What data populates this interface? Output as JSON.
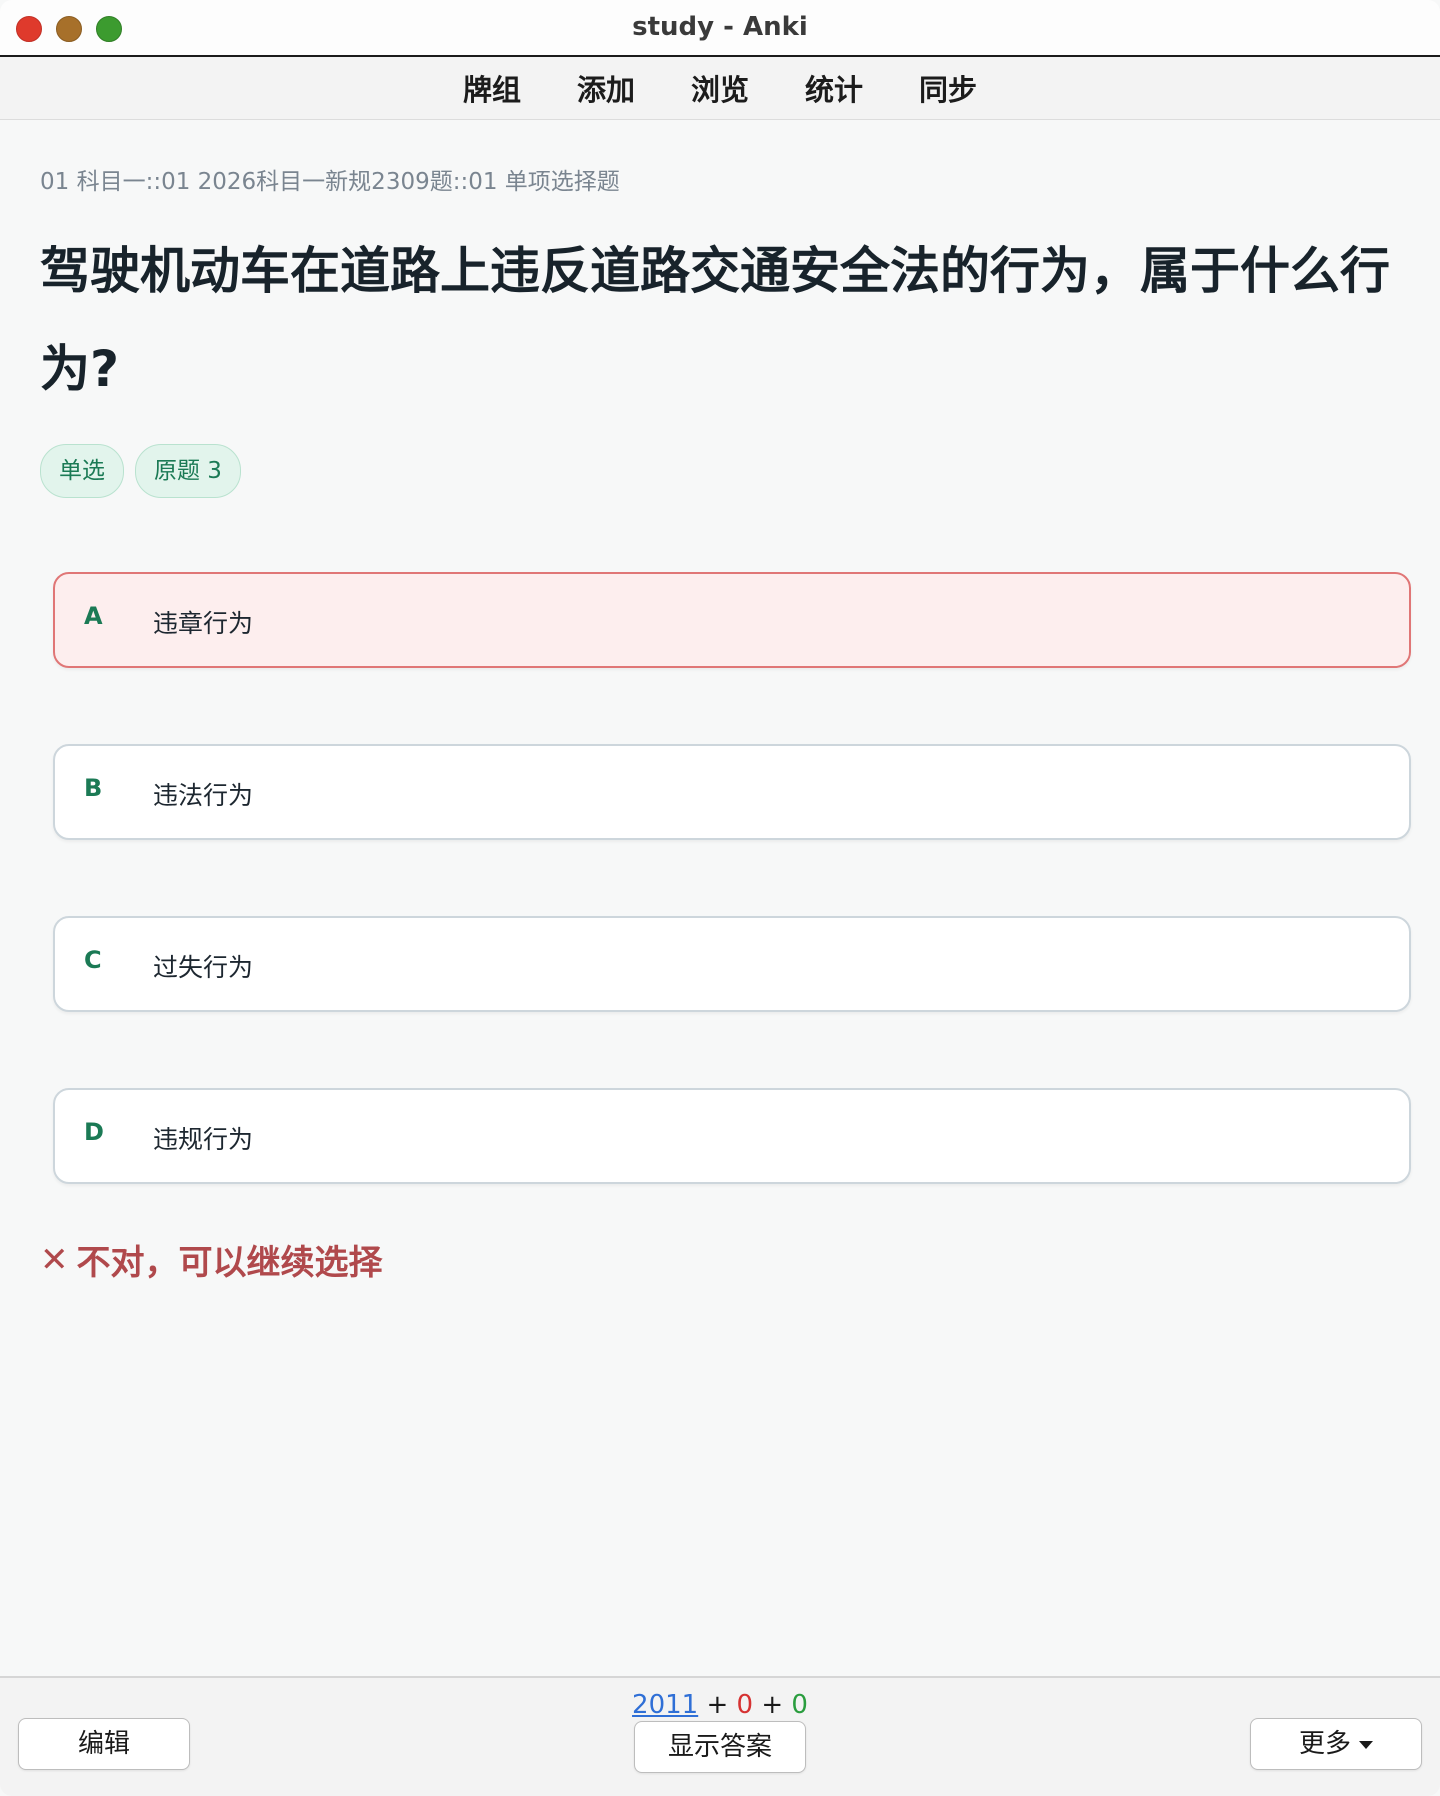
{
  "window": {
    "title": "study - Anki"
  },
  "toolbar": {
    "items": [
      {
        "label": "牌组"
      },
      {
        "label": "添加"
      },
      {
        "label": "浏览"
      },
      {
        "label": "统计"
      },
      {
        "label": "同步"
      }
    ]
  },
  "card": {
    "deck_path": "01 科目一::01 2026科目一新规2309题::01 单项选择题",
    "question": "驾驶机动车在道路上违反道路交通安全法的行为，属于什么行为?",
    "tags": [
      "单选",
      "原题 3"
    ],
    "options": [
      {
        "letter": "A",
        "text": "违章行为",
        "state": "wrong"
      },
      {
        "letter": "B",
        "text": "违法行为",
        "state": "normal"
      },
      {
        "letter": "C",
        "text": "过失行为",
        "state": "normal"
      },
      {
        "letter": "D",
        "text": "违规行为",
        "state": "normal"
      }
    ],
    "feedback": {
      "icon": "✕",
      "text": "不对，可以继续选择"
    }
  },
  "bottom": {
    "counts": {
      "new": "2011",
      "sep1": " + ",
      "learn": "0",
      "sep2": " + ",
      "review": "0"
    },
    "edit_label": "编辑",
    "show_answer_label": "显示答案",
    "more_label": "更多"
  },
  "colors": {
    "accent_green": "#1b7a55",
    "wrong_red": "#b0494c",
    "new_blue": "#2f6fd6",
    "learn_red": "#d63232",
    "review_green": "#2a9d3e"
  }
}
